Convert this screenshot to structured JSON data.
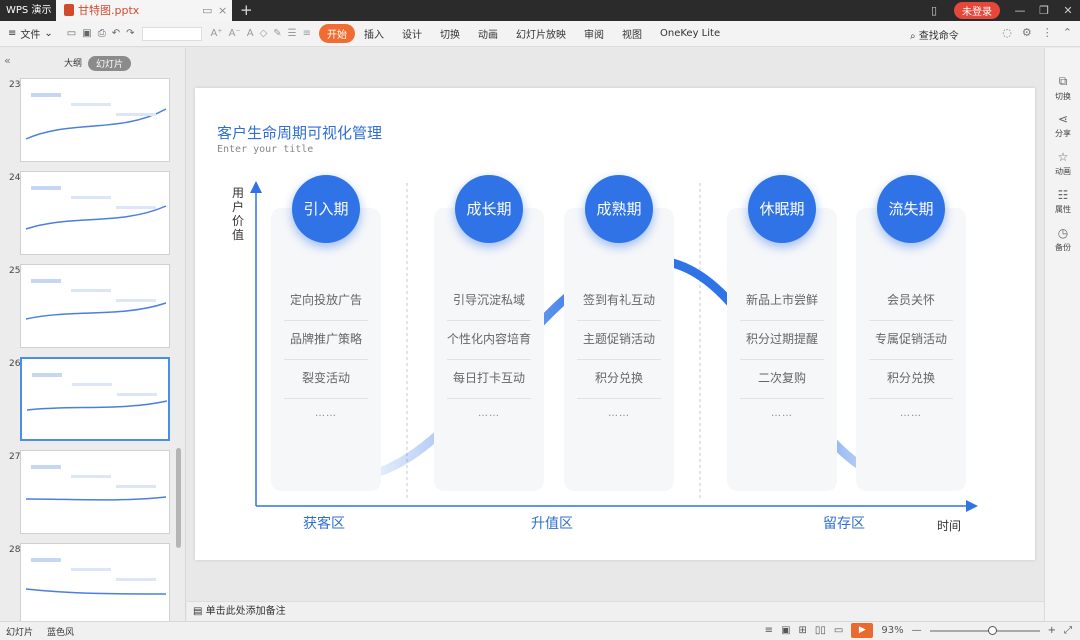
{
  "titlebar": {
    "app_tab": "WPS 演示",
    "file_tab": "甘特图.pptx",
    "login": "未登录"
  },
  "toolbar": {
    "file_menu": "文件",
    "tabs": [
      "开始",
      "插入",
      "设计",
      "切换",
      "动画",
      "幻灯片放映",
      "审阅",
      "视图",
      "OneKey Lite"
    ],
    "active_tab": "开始",
    "search": "查找命令"
  },
  "leftpanel": {
    "tab_outline": "大纲",
    "tab_slides": "幻灯片",
    "slide_numbers": [
      "23",
      "24",
      "25",
      "26",
      "27",
      "28"
    ],
    "selected_slide": "26"
  },
  "slide": {
    "title": "客户生命周期可视化管理",
    "subtitle": "Enter your title",
    "y_axis_label": "用户价值",
    "x_axis_label": "时间",
    "zones": [
      "获客区",
      "升值区",
      "留存区"
    ],
    "phases": [
      {
        "name": "引入期",
        "items": [
          "定向投放广告",
          "品牌推广策略",
          "裂变活动",
          "……"
        ]
      },
      {
        "name": "成长期",
        "items": [
          "引导沉淀私域",
          "个性化内容培育",
          "每日打卡互动",
          "……"
        ]
      },
      {
        "name": "成熟期",
        "items": [
          "签到有礼互动",
          "主题促销活动",
          "积分兑换",
          "……"
        ]
      },
      {
        "name": "休眠期",
        "items": [
          "新品上市尝鲜",
          "积分过期提醒",
          "二次复购",
          "……"
        ]
      },
      {
        "name": "流失期",
        "items": [
          "会员关怀",
          "专属促销活动",
          "积分兑换",
          "……"
        ]
      }
    ]
  },
  "notes_placeholder": "单击此处添加备注",
  "rightpanel": [
    "切换",
    "分享",
    "动画",
    "属性",
    "备份"
  ],
  "statusbar": {
    "slides": "幻灯片",
    "theme": "蓝色风",
    "zoom": "93%"
  },
  "colors": {
    "accent_blue": "#2f73e6",
    "active_tab": "#f06c32",
    "login_red": "#e5473b"
  }
}
